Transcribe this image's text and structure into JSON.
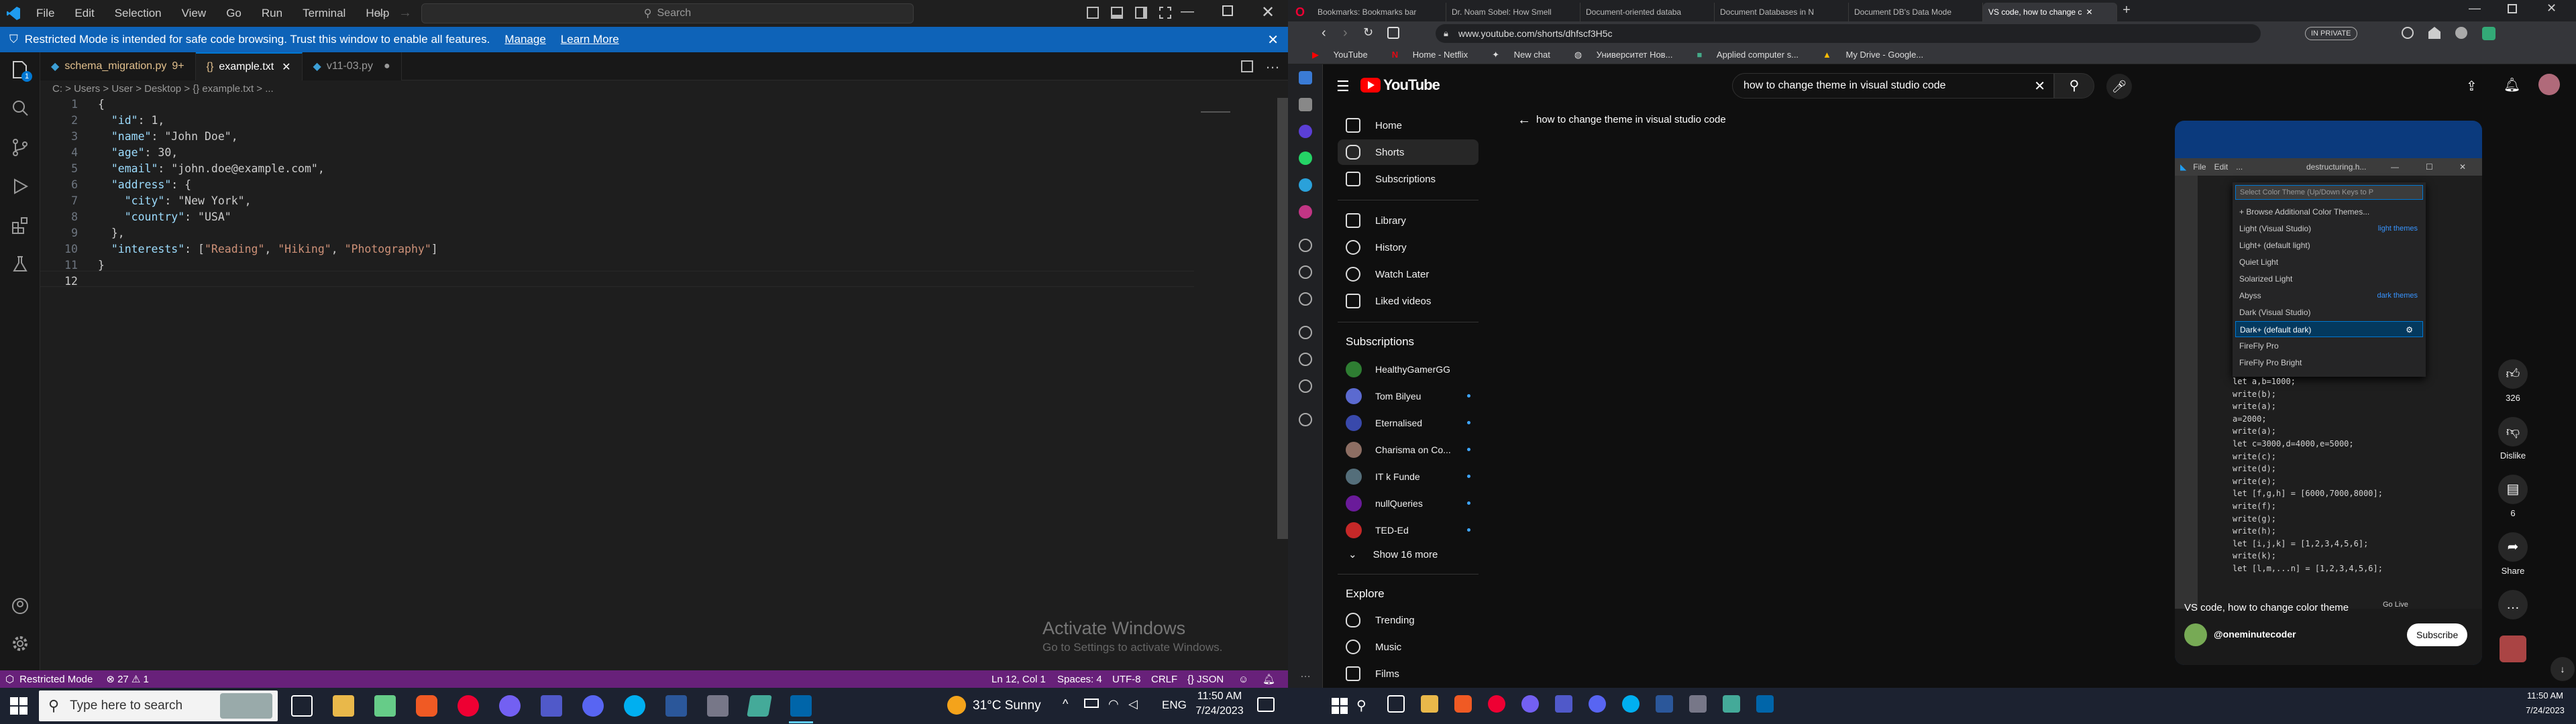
{
  "vscode": {
    "menu": [
      "File",
      "Edit",
      "Selection",
      "View",
      "Go",
      "Run",
      "Terminal",
      "Help"
    ],
    "search_placeholder": "Search",
    "banner": {
      "text": "Restricted Mode is intended for safe code browsing. Trust this window to enable all features.",
      "manage": "Manage",
      "learn_more": "Learn More"
    },
    "tabs": [
      {
        "label": "schema_migration.py",
        "badge": "9+"
      },
      {
        "label": "example.txt",
        "badge": ""
      },
      {
        "label": "v11-03.py",
        "badge": ""
      }
    ],
    "breadcrumb": "C: > Users > User > Desktop > {} example.txt > ...",
    "code_lines": [
      "{",
      "  \"id\": 1,",
      "  \"name\": \"John Doe\",",
      "  \"age\": 30,",
      "  \"email\": \"john.doe@example.com\",",
      "  \"address\": {",
      "    \"city\": \"New York\",",
      "    \"country\": \"USA\"",
      "  },",
      "  \"interests\": [\"Reading\", \"Hiking\", \"Photography\"]",
      "}",
      ""
    ],
    "watermark": {
      "title": "Activate Windows",
      "sub": "Go to Settings to activate Windows."
    },
    "status": {
      "mode": "Restricted Mode",
      "problems": "⊗ 27 ⚠ 1",
      "position": "Ln 12, Col 1",
      "spaces": "Spaces: 4",
      "encoding": "UTF-8",
      "eol": "CRLF",
      "language": "{} JSON"
    },
    "activity_badge": "1"
  },
  "taskbar_left": {
    "search_placeholder": "Type here to search",
    "weather": "31°C  Sunny",
    "lang": "ENG",
    "time": "11:50 AM",
    "date": "7/24/2023"
  },
  "chrome": {
    "tabs": [
      "Bookmarks: Bookmarks bar",
      "Dr. Noam Sobel: How Smell",
      "Document-oriented databa",
      "Document Databases in N",
      "Document DB's Data Mode",
      "VS code, how to change c"
    ],
    "url": "www.youtube.com/shorts/dhfscf3H5c",
    "incognito_label": "IN PRIVATE",
    "bookmarks": [
      "YouTube",
      "Home - Netflix",
      "New chat",
      "Университет Нов...",
      "Applied computer s...",
      "My Drive - Google..."
    ]
  },
  "youtube": {
    "search_query": "how to change theme in visual studio code",
    "back_title": "how to change theme in visual studio code",
    "nav": [
      "Home",
      "Shorts",
      "Subscriptions",
      "Library",
      "History",
      "Watch Later",
      "Liked videos"
    ],
    "subs_header": "Subscriptions",
    "subscriptions": [
      "HealthyGamerGG",
      "Tom Bilyeu",
      "Eternalised",
      "Charisma on Co...",
      "IT k Funde",
      "nullQueries",
      "TED-Ed"
    ],
    "show_more": "Show 16 more",
    "explore_header": "Explore",
    "explore": [
      "Trending",
      "Music",
      "Films"
    ],
    "short": {
      "vs_menu": [
        "File",
        "Edit",
        "..."
      ],
      "vs_title": "destructuring.h...",
      "picker_placeholder": "Select Color Theme (Up/Down Keys to P",
      "themes": [
        {
          "label": "+ Browse Additional Color Themes...",
          "tag": ""
        },
        {
          "label": "Light (Visual Studio)",
          "tag": "light themes"
        },
        {
          "label": "Light+ (default light)",
          "tag": ""
        },
        {
          "label": "Quiet Light",
          "tag": ""
        },
        {
          "label": "Solarized Light",
          "tag": ""
        },
        {
          "label": "Abyss",
          "tag": "dark themes"
        },
        {
          "label": "Dark (Visual Studio)",
          "tag": ""
        },
        {
          "label": "Dark+ (default dark)",
          "tag": ""
        },
        {
          "label": "FireFly Pro",
          "tag": ""
        },
        {
          "label": "FireFly Pro Bright",
          "tag": ""
        }
      ],
      "selected_theme_index": 7,
      "code": [
        "let a,b=1000;",
        "write(b);",
        "write(a);",
        "a=2000;",
        "write(a);",
        "let c=3000,d=4000,e=5000;",
        "write(c);",
        "write(d);",
        "write(e);",
        "let [f,g,h] = [6000,7000,8000];",
        "write(f);",
        "write(g);",
        "write(h);",
        "let [i,j,k] = [1,2,3,4,5,6];",
        "write(k);",
        "let [l,m,...n] = [1,2,3,4,5,6];"
      ],
      "caption": "VS code, how to change color theme",
      "golive": "Go Live",
      "channel": "@oneminutecoder",
      "subscribe": "Subscribe"
    },
    "actions": {
      "likes": "326",
      "dislike": "Dislike",
      "comments": "6",
      "share": "Share"
    }
  },
  "taskbar_right": {
    "time": "11:50 AM",
    "date": "7/24/2023"
  }
}
